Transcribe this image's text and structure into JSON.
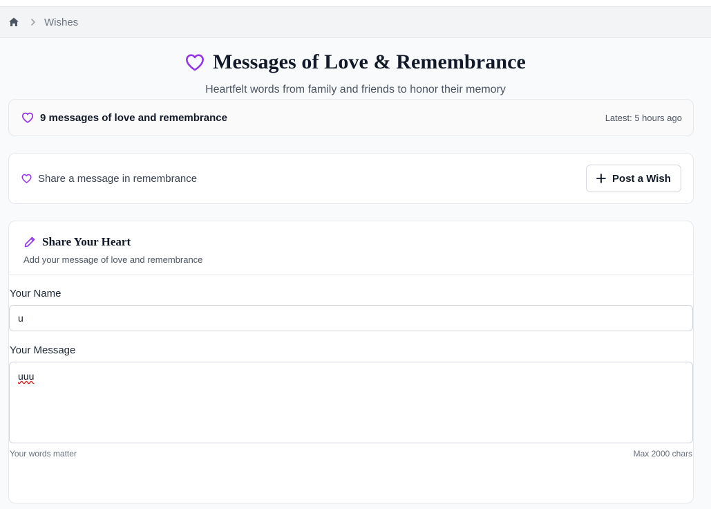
{
  "breadcrumb": {
    "home_icon": "home-icon",
    "separator_icon": "chevron-right-icon",
    "current": "Wishes"
  },
  "header": {
    "icon": "heart-outline-icon",
    "title": "Messages of Love & Remembrance",
    "subtitle": "Heartfelt words from family and friends to honor their memory"
  },
  "summary": {
    "icon": "heart-outline-icon",
    "count_text": "9 messages of love and remembrance",
    "latest": "Latest: 5 hours ago"
  },
  "share": {
    "icon": "heart-outline-icon",
    "prompt": "Share a message in remembrance",
    "button_icon": "plus-icon",
    "button_label": "Post a Wish"
  },
  "form": {
    "icon": "pencil-icon",
    "title": "Share Your Heart",
    "subtitle": "Add your message of love and remembrance",
    "name_label": "Your Name",
    "name_value": "u",
    "message_label": "Your Message",
    "message_value": "uuu",
    "hint_left": "Your words matter",
    "hint_right": "Max 2000 chars"
  },
  "colors": {
    "accent": "#9333ea",
    "text": "#111827",
    "muted": "#6b7280",
    "border": "#e5e7eb"
  }
}
